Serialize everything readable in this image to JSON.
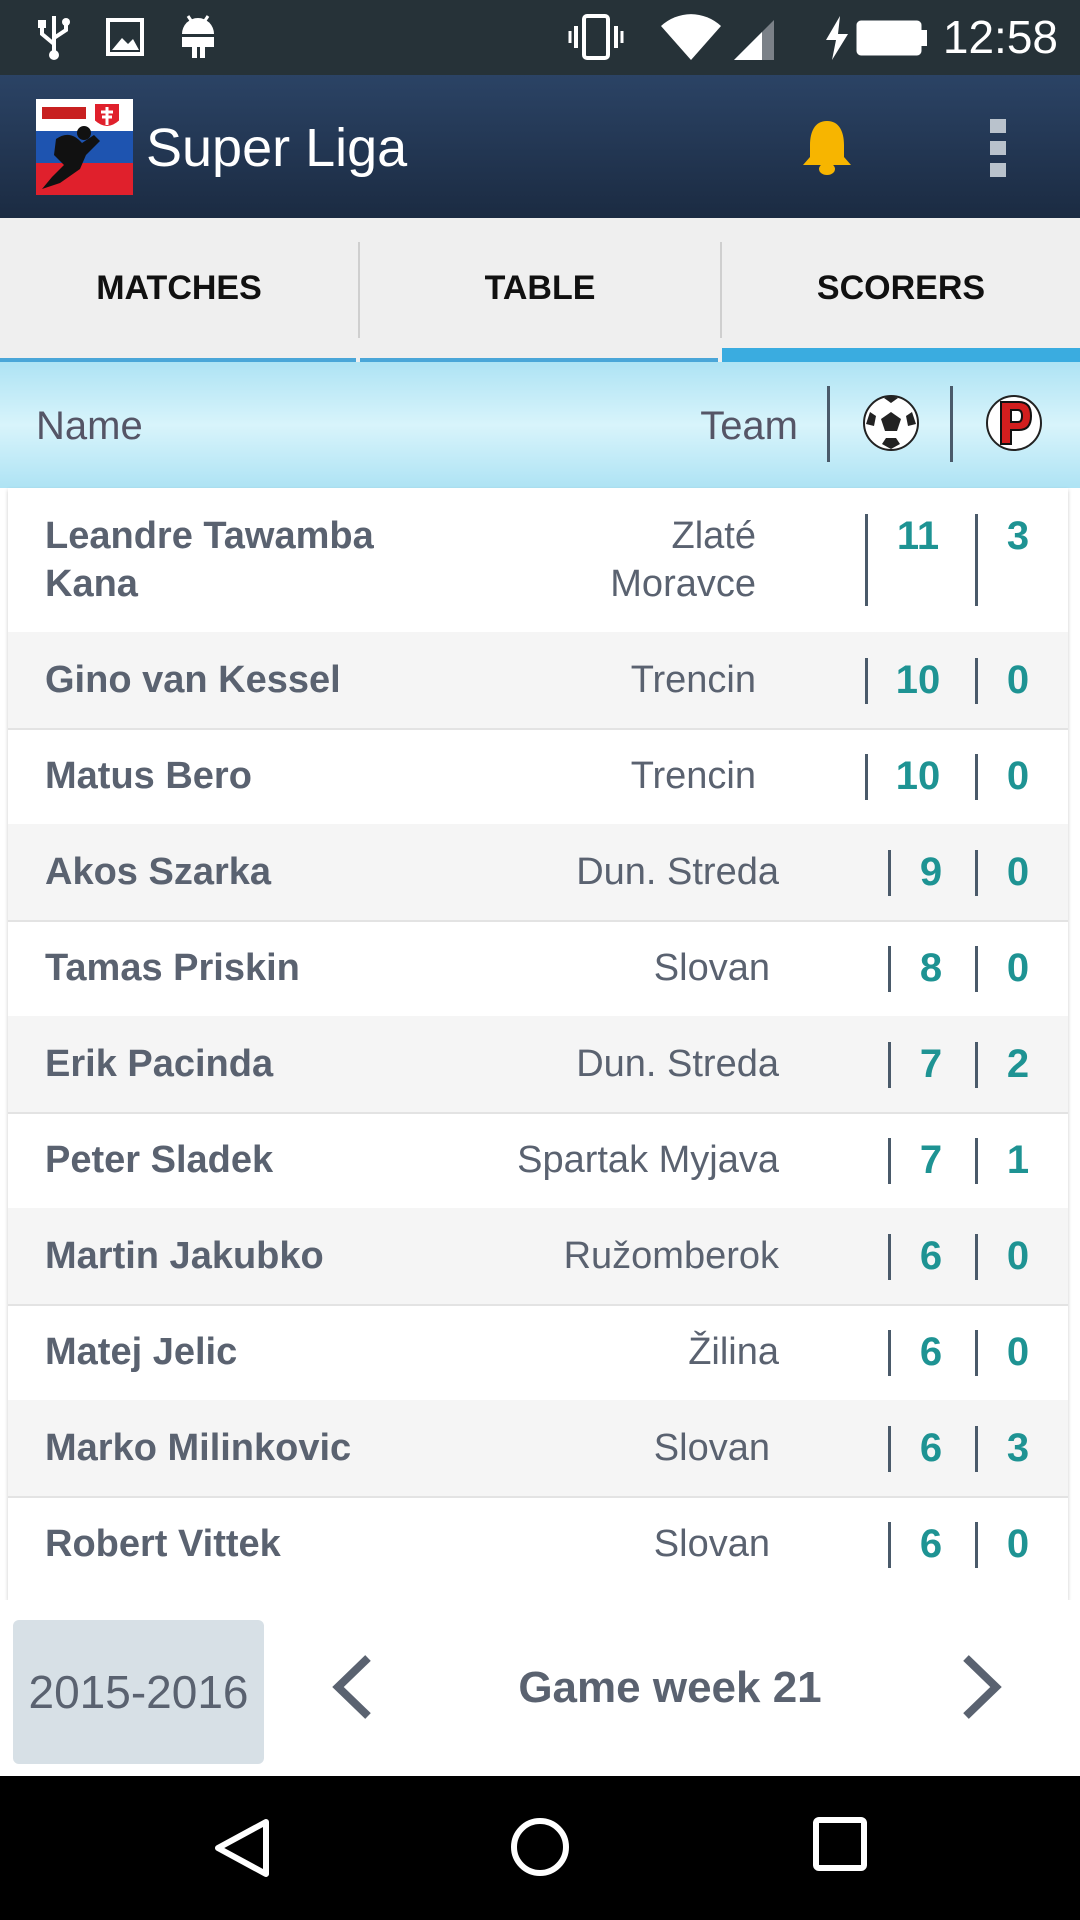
{
  "status_bar": {
    "time": "12:58",
    "icons": [
      "usb-icon",
      "image-icon",
      "android-icon",
      "vibrate-icon",
      "wifi-icon",
      "signal-icon",
      "battery-charging-icon"
    ]
  },
  "app_bar": {
    "title": "Super Liga",
    "icons": [
      "app-logo",
      "bell-icon",
      "overflow-menu-icon"
    ]
  },
  "tabs": [
    {
      "label": "MATCHES",
      "active": false
    },
    {
      "label": "TABLE",
      "active": false
    },
    {
      "label": "SCORERS",
      "active": true
    }
  ],
  "table_header": {
    "name": "Name",
    "team": "Team",
    "goals_icon": "soccer-ball-icon",
    "penalties_icon": "penalty-icon"
  },
  "scorers": [
    {
      "name": "Leandre Tawamba Kana",
      "team": "Zlaté Moravce",
      "goals": "11",
      "penalties": "3"
    },
    {
      "name": "Gino van Kessel",
      "team": "Trencin",
      "goals": "10",
      "penalties": "0"
    },
    {
      "name": "Matus Bero",
      "team": "Trencin",
      "goals": "10",
      "penalties": "0"
    },
    {
      "name": "Akos Szarka",
      "team": "Dun. Streda",
      "goals": "9",
      "penalties": "0"
    },
    {
      "name": "Tamas Priskin",
      "team": "Slovan",
      "goals": "8",
      "penalties": "0"
    },
    {
      "name": "Erik Pacinda",
      "team": "Dun. Streda",
      "goals": "7",
      "penalties": "2"
    },
    {
      "name": "Peter Sladek",
      "team": "Spartak Myjava",
      "goals": "7",
      "penalties": "1"
    },
    {
      "name": "Martin Jakubko",
      "team": "Ružomberok",
      "goals": "6",
      "penalties": "0"
    },
    {
      "name": "Matej Jelic",
      "team": "Žilina",
      "goals": "6",
      "penalties": "0"
    },
    {
      "name": "Marko Milinkovic",
      "team": "Slovan",
      "goals": "6",
      "penalties": "3"
    },
    {
      "name": "Robert Vittek",
      "team": "Slovan",
      "goals": "6",
      "penalties": "0"
    }
  ],
  "footer": {
    "season": "2015-2016",
    "game_week": "Game week 21",
    "prev_icon": "chevron-left-icon",
    "next_icon": "chevron-right-icon"
  },
  "nav_bar": {
    "icons": [
      "back-icon",
      "home-icon",
      "recents-icon"
    ]
  },
  "colors": {
    "app_bar": "#1f3250",
    "accent": "#3aace0",
    "number": "#1e9393",
    "text": "#5a6270"
  }
}
